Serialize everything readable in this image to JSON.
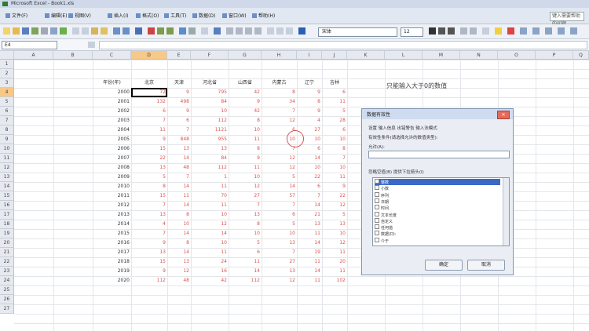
{
  "window": {
    "title": "Microsoft Excel - Book1.xls"
  },
  "menu": {
    "items": [
      "文件(F)",
      "编辑(E)",
      "视图(V)",
      "插入(I)",
      "格式(O)",
      "工具(T)",
      "数据(D)",
      "窗口(W)",
      "帮助(H)"
    ],
    "help_placeholder": "键入需要帮助的问题"
  },
  "toolbar": {
    "font_name": "宋体",
    "font_size": "12"
  },
  "formula": {
    "name_box": "E4"
  },
  "columns": [
    "A",
    "B",
    "C",
    "D",
    "E",
    "F",
    "G",
    "H",
    "I",
    "J",
    "K",
    "L",
    "M",
    "N",
    "O",
    "P",
    "Q"
  ],
  "rows": [
    "1",
    "2",
    "3",
    "4",
    "5",
    "6",
    "7",
    "8",
    "9",
    "10",
    "11",
    "12",
    "13",
    "14",
    "15",
    "16",
    "17",
    "18",
    "19",
    "20",
    "21",
    "22",
    "23",
    "24",
    "25",
    "26",
    "27"
  ],
  "table": {
    "headers": [
      "年份(年)",
      "北京",
      "天津",
      "河北省",
      "山西省",
      "内蒙古",
      "辽宁",
      "吉林"
    ],
    "rows": [
      [
        "2000",
        "72",
        "9",
        "795",
        "42",
        "8",
        "9",
        "6"
      ],
      [
        "2001",
        "132",
        "498",
        "84",
        "9",
        "34",
        "8",
        "11"
      ],
      [
        "2002",
        "6",
        "9",
        "10",
        "42",
        "7",
        "9",
        "5"
      ],
      [
        "2003",
        "7",
        "6",
        "112",
        "8",
        "12",
        "4",
        "28"
      ],
      [
        "2004",
        "11",
        "7",
        "1121",
        "10",
        "6",
        "27",
        "6"
      ],
      [
        "2005",
        "9",
        "848",
        "955",
        "11",
        "10",
        "10",
        "10"
      ],
      [
        "2006",
        "15",
        "13",
        "13",
        "8",
        "7",
        "6",
        "8"
      ],
      [
        "2007",
        "22",
        "14",
        "84",
        "9",
        "12",
        "14",
        "7"
      ],
      [
        "2008",
        "13",
        "48",
        "112",
        "11",
        "12",
        "10",
        "10"
      ],
      [
        "2009",
        "5",
        "7",
        "1",
        "10",
        "5",
        "22",
        "11"
      ],
      [
        "2010",
        "8",
        "14",
        "11",
        "12",
        "14",
        "6",
        "9"
      ],
      [
        "2011",
        "15",
        "11",
        "70",
        "27",
        "57",
        "7",
        "22"
      ],
      [
        "2012",
        "7",
        "14",
        "11",
        "7",
        "7",
        "14",
        "12"
      ],
      [
        "2013",
        "13",
        "8",
        "10",
        "13",
        "6",
        "21",
        "5"
      ],
      [
        "2014",
        "4",
        "10",
        "12",
        "8",
        "5",
        "13",
        "13"
      ],
      [
        "2015",
        "7",
        "14",
        "14",
        "10",
        "10",
        "11",
        "10"
      ],
      [
        "2016",
        "9",
        "8",
        "10",
        "5",
        "13",
        "14",
        "12"
      ],
      [
        "2017",
        "13",
        "14",
        "11",
        "6",
        "7",
        "19",
        "11"
      ],
      [
        "2018",
        "15",
        "13",
        "24",
        "11",
        "27",
        "11",
        "20"
      ],
      [
        "2019",
        "9",
        "12",
        "16",
        "14",
        "13",
        "14",
        "11"
      ],
      [
        "2020",
        "112",
        "48",
        "42",
        "112",
        "12",
        "11",
        "102"
      ]
    ]
  },
  "note": "只能输入大于0的数值",
  "dialog": {
    "title": "数据有效性",
    "line1": "设置  输入信息  出错警告  输入法模式",
    "line2": "有效性条件(请选择允许的数值类型):",
    "line3": "允许(A):",
    "line4": "忽略空值(B)    提供下拉箭头(I)",
    "list_items": [
      "整数",
      "小数",
      "序列",
      "日期",
      "时间",
      "文本长度",
      "自定义",
      "任何值",
      "数据(D):",
      "介于"
    ],
    "ok": "确定",
    "cancel": "取消"
  },
  "colors": {
    "accent": "#3b68c7",
    "value_red": "#d9534f",
    "selected_header": "#f7c886"
  }
}
